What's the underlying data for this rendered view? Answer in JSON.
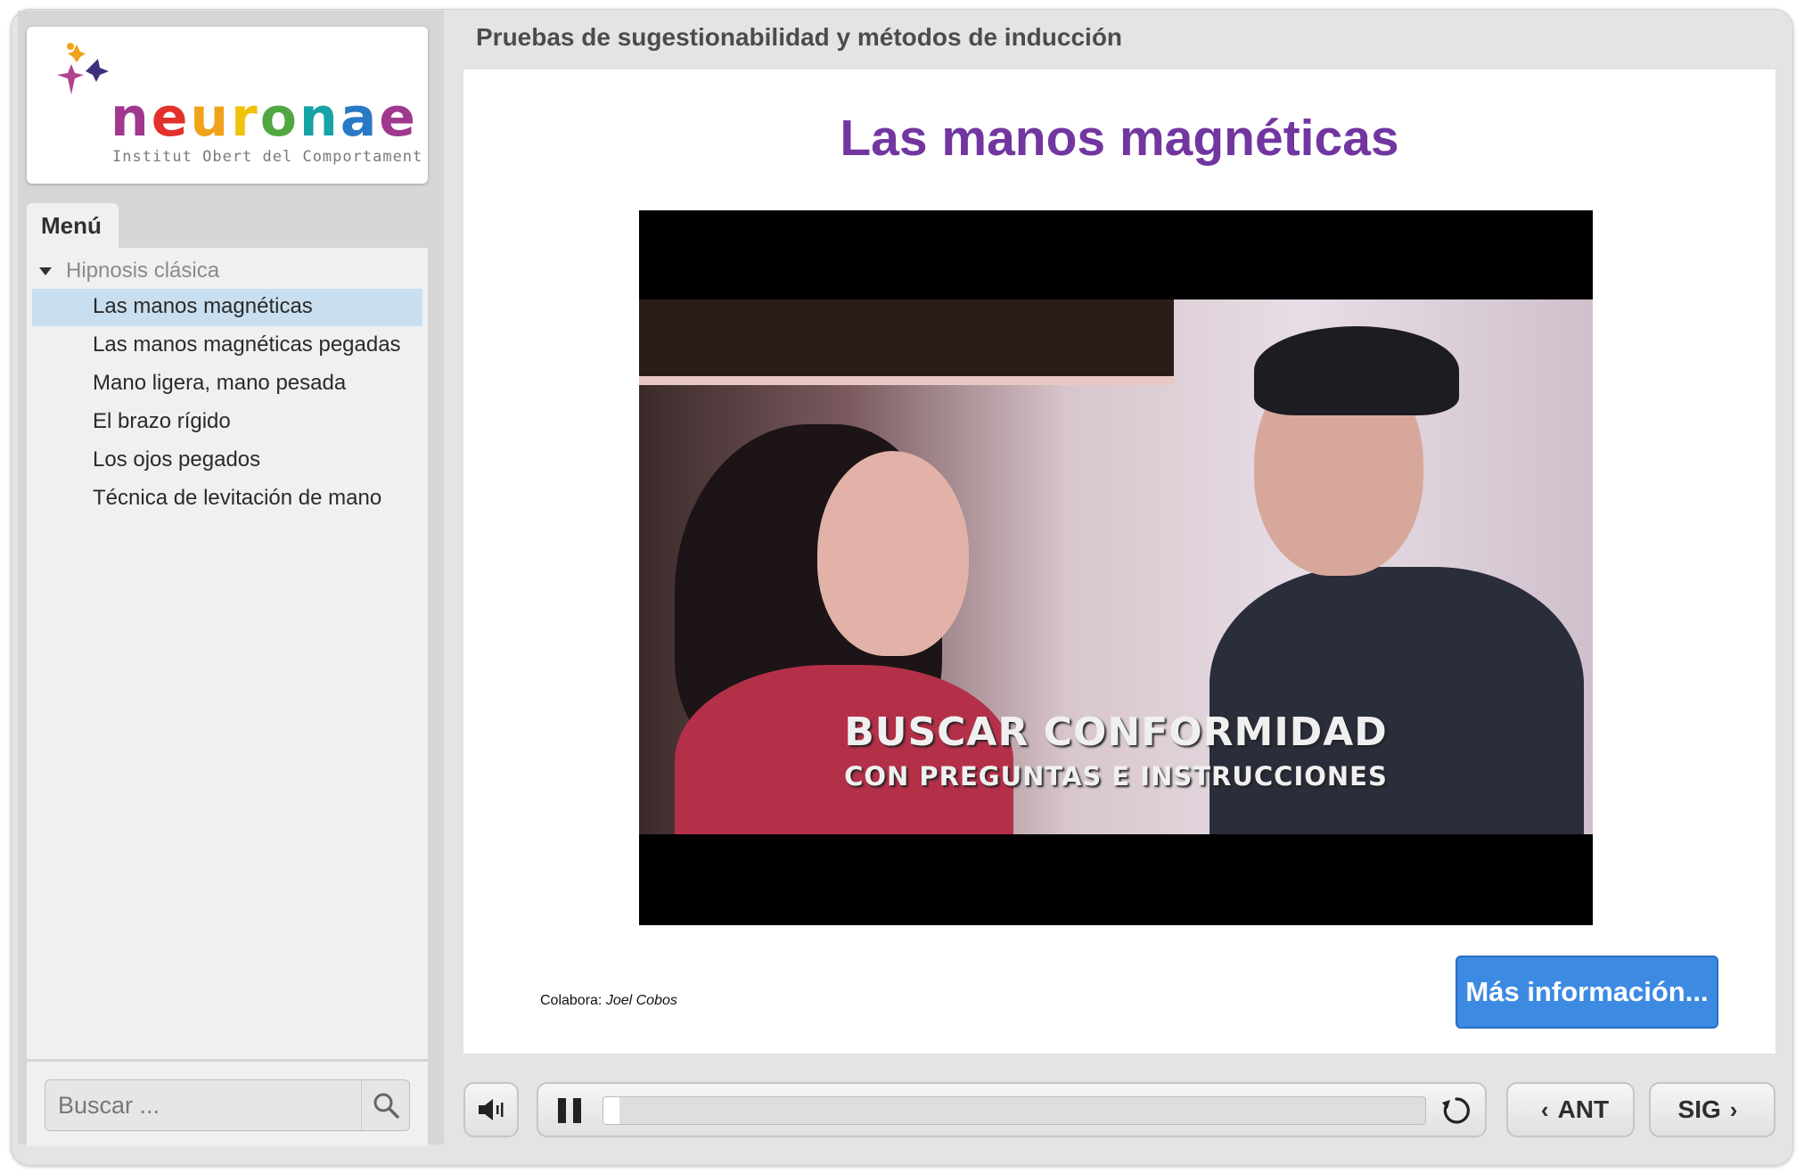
{
  "logo": {
    "letters": [
      "n",
      "e",
      "u",
      "r",
      "o",
      "n",
      "a",
      "e"
    ],
    "letter_colors": [
      "#a0388f",
      "#e2302c",
      "#f0a21a",
      "#f2c10a",
      "#52a840",
      "#16a3a5",
      "#2979c4",
      "#a0388f"
    ],
    "subtitle": "Institut Obert del Comportament"
  },
  "sidebar": {
    "menu_tab": "Menú",
    "section": {
      "label": "Hipnosis clásica",
      "expanded": true
    },
    "items": [
      {
        "label": "Las manos magnéticas",
        "active": true
      },
      {
        "label": "Las manos magnéticas pegadas",
        "active": false
      },
      {
        "label": "Mano ligera, mano pesada",
        "active": false
      },
      {
        "label": "El brazo rígido",
        "active": false
      },
      {
        "label": "Los ojos pegados",
        "active": false
      },
      {
        "label": "Técnica de levitación de mano",
        "active": false
      }
    ],
    "search": {
      "placeholder": "Buscar ...",
      "icon": "magnifier-icon"
    }
  },
  "course_title": "Pruebas de sugestionabilidad y métodos de inducción",
  "slide": {
    "title": "Las manos magnéticas",
    "title_color": "#7236a0",
    "video": {
      "caption_line1": "BUSCAR CONFORMIDAD",
      "caption_line2": "CON PREGUNTAS E INSTRUCCIONES"
    },
    "credit_label": "Colabora:",
    "credit_name": "Joel Cobos",
    "more_button": "Más información...",
    "more_button_color": "#3d8ae2"
  },
  "controls": {
    "volume_icon": "speaker-icon",
    "play_state_icon": "pause-icon",
    "progress_fraction": 0.02,
    "replay_icon": "replay-icon",
    "prev_label": "ANT",
    "next_label": "SIG"
  }
}
